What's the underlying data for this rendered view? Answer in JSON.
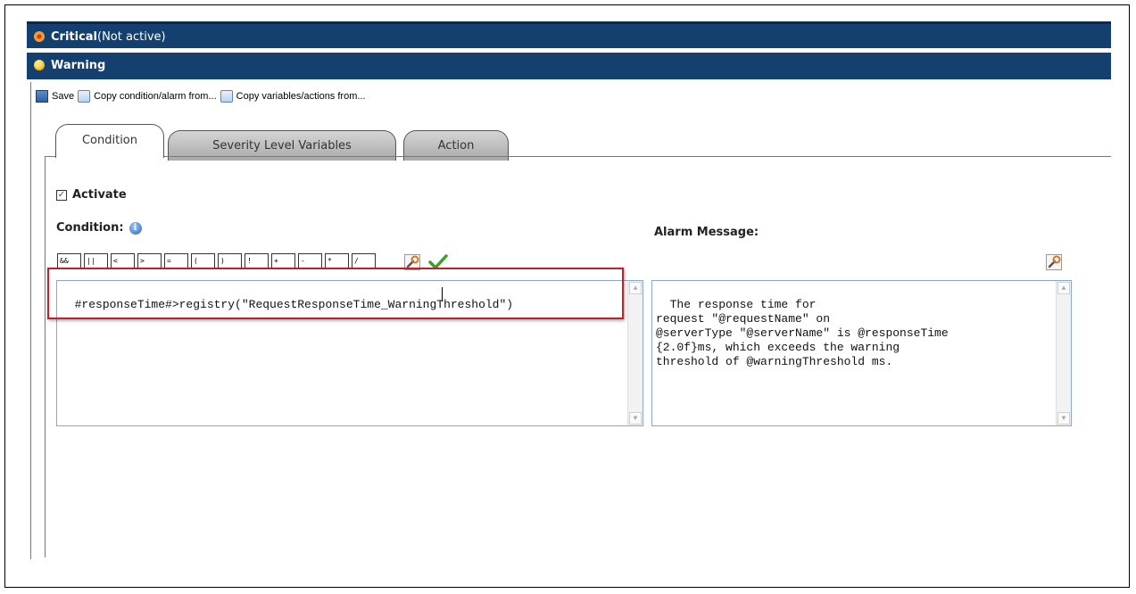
{
  "severity_bars": {
    "critical": {
      "title": "Critical",
      "suffix": "(Not active)"
    },
    "warning": {
      "title": "Warning"
    }
  },
  "toolbar": {
    "save_label": "Save",
    "copy_condition_label": "Copy condition/alarm from...",
    "copy_variables_label": "Copy variables/actions from..."
  },
  "tabs": [
    {
      "label": "Condition",
      "active": true
    },
    {
      "label": "Severity Level Variables",
      "active": false
    },
    {
      "label": "Action",
      "active": false
    }
  ],
  "condition_panel": {
    "activate_label": "Activate",
    "activate_checked": true,
    "condition_label": "Condition:",
    "operators": [
      "&&",
      "||",
      "<",
      ">",
      "=",
      "(",
      ")",
      "!",
      "+",
      "-",
      "*",
      "/"
    ],
    "condition_text": "#responseTime#>registry(\"RequestResponseTime_WarningThreshold\")",
    "alarm_label": "Alarm Message:",
    "alarm_text": "The response time for\nrequest \"@requestName\" on\n@serverType \"@serverName\" is @responseTime\n{2.0f}ms, which exceeds the warning\nthreshold of @warningThreshold ms."
  },
  "colors": {
    "header_bar": "#13406e",
    "highlight": "#c0202a",
    "critical_dot": "#e8732a",
    "warning_dot": "#f0b400"
  }
}
